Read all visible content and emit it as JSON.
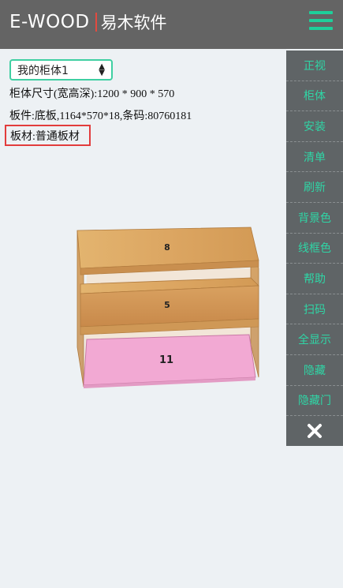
{
  "header": {
    "logo_text": "E-WOOD",
    "app_name": "易木软件",
    "menu_icon": "hamburger-menu-icon",
    "accent_color": "#1ecf9a",
    "bg_color": "#646464"
  },
  "cabinet_select": {
    "selected": "我的柜体1"
  },
  "info": {
    "dimensions": "柜体尺寸(宽高深):1200 * 900 * 570",
    "panel": "板件:底板,1164*570*18,条码:80760181",
    "material": "板材:普通板材"
  },
  "sidebar": {
    "items": [
      {
        "label": "正视"
      },
      {
        "label": "柜体"
      },
      {
        "label": "安装"
      },
      {
        "label": "清单"
      },
      {
        "label": "刷新"
      },
      {
        "label": "背景色"
      },
      {
        "label": "线框色"
      },
      {
        "label": "帮助"
      },
      {
        "label": "扫码"
      },
      {
        "label": "全显示"
      },
      {
        "label": "隐藏"
      },
      {
        "label": "隐藏门"
      }
    ],
    "close_icon": "close-icon"
  },
  "model": {
    "labels": {
      "top": "8",
      "middle": "5",
      "bottom": "11"
    },
    "wood_color": "#dba762",
    "highlight_color": "#f2a9d3"
  }
}
